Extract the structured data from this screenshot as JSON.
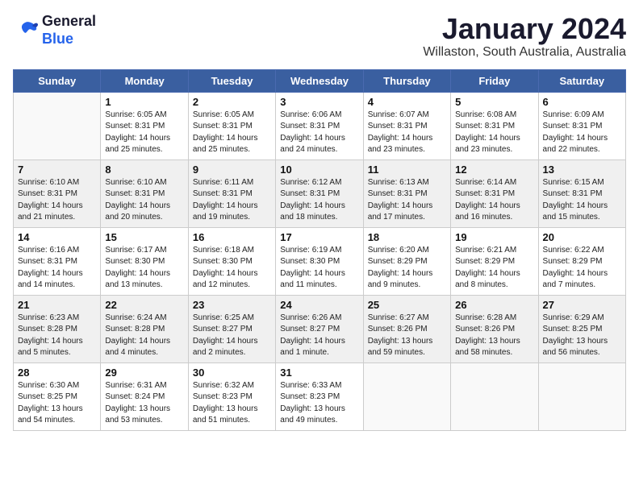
{
  "header": {
    "logo_line1": "General",
    "logo_line2": "Blue",
    "month_title": "January 2024",
    "location": "Willaston, South Australia, Australia"
  },
  "weekdays": [
    "Sunday",
    "Monday",
    "Tuesday",
    "Wednesday",
    "Thursday",
    "Friday",
    "Saturday"
  ],
  "weeks": [
    [
      {
        "day": "",
        "text": ""
      },
      {
        "day": "1",
        "text": "Sunrise: 6:05 AM\nSunset: 8:31 PM\nDaylight: 14 hours\nand 25 minutes."
      },
      {
        "day": "2",
        "text": "Sunrise: 6:05 AM\nSunset: 8:31 PM\nDaylight: 14 hours\nand 25 minutes."
      },
      {
        "day": "3",
        "text": "Sunrise: 6:06 AM\nSunset: 8:31 PM\nDaylight: 14 hours\nand 24 minutes."
      },
      {
        "day": "4",
        "text": "Sunrise: 6:07 AM\nSunset: 8:31 PM\nDaylight: 14 hours\nand 23 minutes."
      },
      {
        "day": "5",
        "text": "Sunrise: 6:08 AM\nSunset: 8:31 PM\nDaylight: 14 hours\nand 23 minutes."
      },
      {
        "day": "6",
        "text": "Sunrise: 6:09 AM\nSunset: 8:31 PM\nDaylight: 14 hours\nand 22 minutes."
      }
    ],
    [
      {
        "day": "7",
        "text": "Sunrise: 6:10 AM\nSunset: 8:31 PM\nDaylight: 14 hours\nand 21 minutes."
      },
      {
        "day": "8",
        "text": "Sunrise: 6:10 AM\nSunset: 8:31 PM\nDaylight: 14 hours\nand 20 minutes."
      },
      {
        "day": "9",
        "text": "Sunrise: 6:11 AM\nSunset: 8:31 PM\nDaylight: 14 hours\nand 19 minutes."
      },
      {
        "day": "10",
        "text": "Sunrise: 6:12 AM\nSunset: 8:31 PM\nDaylight: 14 hours\nand 18 minutes."
      },
      {
        "day": "11",
        "text": "Sunrise: 6:13 AM\nSunset: 8:31 PM\nDaylight: 14 hours\nand 17 minutes."
      },
      {
        "day": "12",
        "text": "Sunrise: 6:14 AM\nSunset: 8:31 PM\nDaylight: 14 hours\nand 16 minutes."
      },
      {
        "day": "13",
        "text": "Sunrise: 6:15 AM\nSunset: 8:31 PM\nDaylight: 14 hours\nand 15 minutes."
      }
    ],
    [
      {
        "day": "14",
        "text": "Sunrise: 6:16 AM\nSunset: 8:31 PM\nDaylight: 14 hours\nand 14 minutes."
      },
      {
        "day": "15",
        "text": "Sunrise: 6:17 AM\nSunset: 8:30 PM\nDaylight: 14 hours\nand 13 minutes."
      },
      {
        "day": "16",
        "text": "Sunrise: 6:18 AM\nSunset: 8:30 PM\nDaylight: 14 hours\nand 12 minutes."
      },
      {
        "day": "17",
        "text": "Sunrise: 6:19 AM\nSunset: 8:30 PM\nDaylight: 14 hours\nand 11 minutes."
      },
      {
        "day": "18",
        "text": "Sunrise: 6:20 AM\nSunset: 8:29 PM\nDaylight: 14 hours\nand 9 minutes."
      },
      {
        "day": "19",
        "text": "Sunrise: 6:21 AM\nSunset: 8:29 PM\nDaylight: 14 hours\nand 8 minutes."
      },
      {
        "day": "20",
        "text": "Sunrise: 6:22 AM\nSunset: 8:29 PM\nDaylight: 14 hours\nand 7 minutes."
      }
    ],
    [
      {
        "day": "21",
        "text": "Sunrise: 6:23 AM\nSunset: 8:28 PM\nDaylight: 14 hours\nand 5 minutes."
      },
      {
        "day": "22",
        "text": "Sunrise: 6:24 AM\nSunset: 8:28 PM\nDaylight: 14 hours\nand 4 minutes."
      },
      {
        "day": "23",
        "text": "Sunrise: 6:25 AM\nSunset: 8:27 PM\nDaylight: 14 hours\nand 2 minutes."
      },
      {
        "day": "24",
        "text": "Sunrise: 6:26 AM\nSunset: 8:27 PM\nDaylight: 14 hours\nand 1 minute."
      },
      {
        "day": "25",
        "text": "Sunrise: 6:27 AM\nSunset: 8:26 PM\nDaylight: 13 hours\nand 59 minutes."
      },
      {
        "day": "26",
        "text": "Sunrise: 6:28 AM\nSunset: 8:26 PM\nDaylight: 13 hours\nand 58 minutes."
      },
      {
        "day": "27",
        "text": "Sunrise: 6:29 AM\nSunset: 8:25 PM\nDaylight: 13 hours\nand 56 minutes."
      }
    ],
    [
      {
        "day": "28",
        "text": "Sunrise: 6:30 AM\nSunset: 8:25 PM\nDaylight: 13 hours\nand 54 minutes."
      },
      {
        "day": "29",
        "text": "Sunrise: 6:31 AM\nSunset: 8:24 PM\nDaylight: 13 hours\nand 53 minutes."
      },
      {
        "day": "30",
        "text": "Sunrise: 6:32 AM\nSunset: 8:23 PM\nDaylight: 13 hours\nand 51 minutes."
      },
      {
        "day": "31",
        "text": "Sunrise: 6:33 AM\nSunset: 8:23 PM\nDaylight: 13 hours\nand 49 minutes."
      },
      {
        "day": "",
        "text": ""
      },
      {
        "day": "",
        "text": ""
      },
      {
        "day": "",
        "text": ""
      }
    ]
  ]
}
